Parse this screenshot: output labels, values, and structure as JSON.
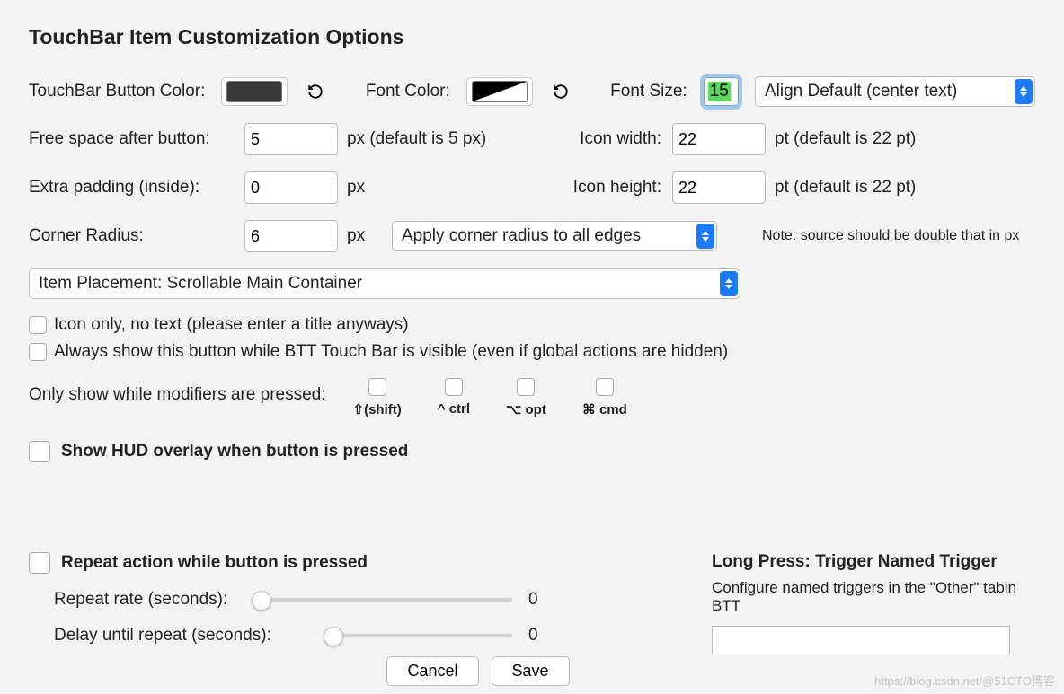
{
  "title": "TouchBar Item Customization Options",
  "row1": {
    "button_color_label": "TouchBar Button Color:",
    "font_color_label": "Font Color:",
    "font_size_label": "Font Size:",
    "font_size_value": "15",
    "align_select": "Align Default (center text)"
  },
  "row2": {
    "free_space_label": "Free space after button:",
    "free_space_value": "5",
    "free_space_unit": "px (default is 5 px)",
    "icon_width_label": "Icon width:",
    "icon_width_value": "22",
    "icon_width_unit": "pt (default is 22 pt)"
  },
  "row3": {
    "extra_padding_label": "Extra padding (inside):",
    "extra_padding_value": "0",
    "extra_padding_unit": "px",
    "icon_height_label": "Icon height:",
    "icon_height_value": "22",
    "icon_height_unit": "pt (default is 22 pt)"
  },
  "row4": {
    "corner_radius_label": "Corner Radius:",
    "corner_radius_value": "6",
    "corner_radius_unit": "px",
    "corner_select": "Apply corner radius to all edges",
    "note": "Note: source should be double that in px"
  },
  "placement_select": "Item Placement: Scrollable Main Container",
  "cb_icon_only": "Icon only, no text (please enter a title anyways)",
  "cb_always_show": "Always show this button while BTT Touch Bar is visible (even if global actions are hidden)",
  "mod_label": "Only show while modifiers are pressed:",
  "mods": {
    "shift": "⇧(shift)",
    "ctrl": "^ ctrl",
    "opt": "⌥ opt",
    "cmd": "⌘ cmd"
  },
  "cb_hud": "Show HUD overlay when button is pressed",
  "repeat": {
    "cb_repeat": "Repeat action while button is pressed",
    "rate_label": "Repeat rate (seconds):",
    "rate_value": "0",
    "delay_label": "Delay until repeat (seconds):",
    "delay_value": "0"
  },
  "longpress": {
    "title": "Long Press: Trigger Named Trigger",
    "desc": "Configure named triggers in the \"Other\" tabin BTT"
  },
  "buttons": {
    "cancel": "Cancel",
    "save": "Save"
  },
  "watermark": "https://blog.csdn.net/@51CTO博客"
}
